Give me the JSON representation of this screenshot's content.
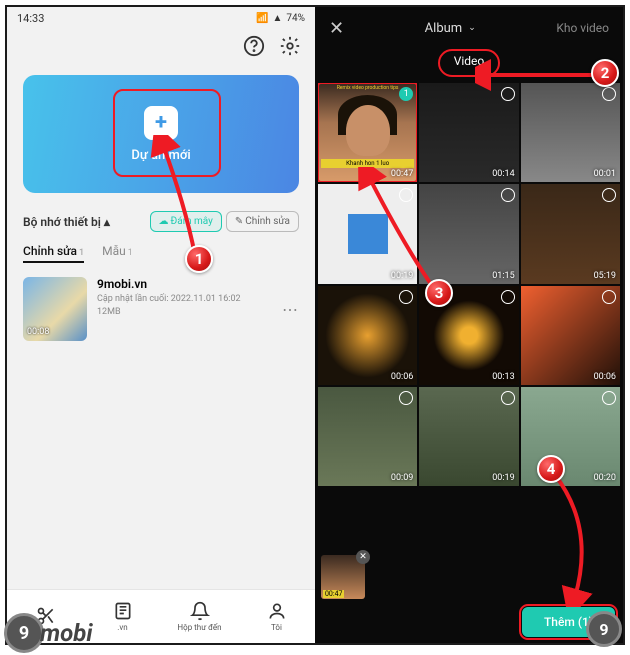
{
  "left": {
    "statusbar": {
      "time": "14:33",
      "battery": "74%"
    },
    "new_project": {
      "label": "Dự án mới"
    },
    "storage": {
      "label": "Bộ nhớ thiết bị",
      "cloud": "Đám mây",
      "edit": "Chỉnh sửa"
    },
    "tabs": {
      "edit": "Chỉnh sửa",
      "template": "Mẫu",
      "edit_count": "1",
      "template_count": "1"
    },
    "project": {
      "title": "9mobi.vn",
      "updated": "Cập nhật lần cuối: 2022.11.01 16:02",
      "size": "12MB",
      "duration": "00:08"
    },
    "nav": {
      "i1": "",
      "i2": ".vn",
      "i3": "Hộp thư đến",
      "i4": "Tôi"
    }
  },
  "right": {
    "top": {
      "album": "Album",
      "kho": "Kho video"
    },
    "tab": {
      "video": "Video"
    },
    "selected_badge": "1",
    "cells": [
      {
        "dur": "00:47",
        "cap": "Khanh hon 1 luo",
        "sel": true
      },
      {
        "dur": "00:14"
      },
      {
        "dur": "00:01"
      },
      {
        "dur": "00:19"
      },
      {
        "dur": "01:15"
      },
      {
        "dur": "05:19"
      },
      {
        "dur": "00:06"
      },
      {
        "dur": "00:13"
      },
      {
        "dur": "00:06"
      },
      {
        "dur": "00:09"
      },
      {
        "dur": "00:19"
      },
      {
        "dur": "00:20"
      }
    ],
    "selthumb_dur": "00:47",
    "add": "Thêm (1)"
  },
  "badges": {
    "b1": "1",
    "b2": "2",
    "b3": "3",
    "b4": "4"
  },
  "wm": {
    "t1": "9",
    "t2": "mobi",
    "t3": "9"
  }
}
